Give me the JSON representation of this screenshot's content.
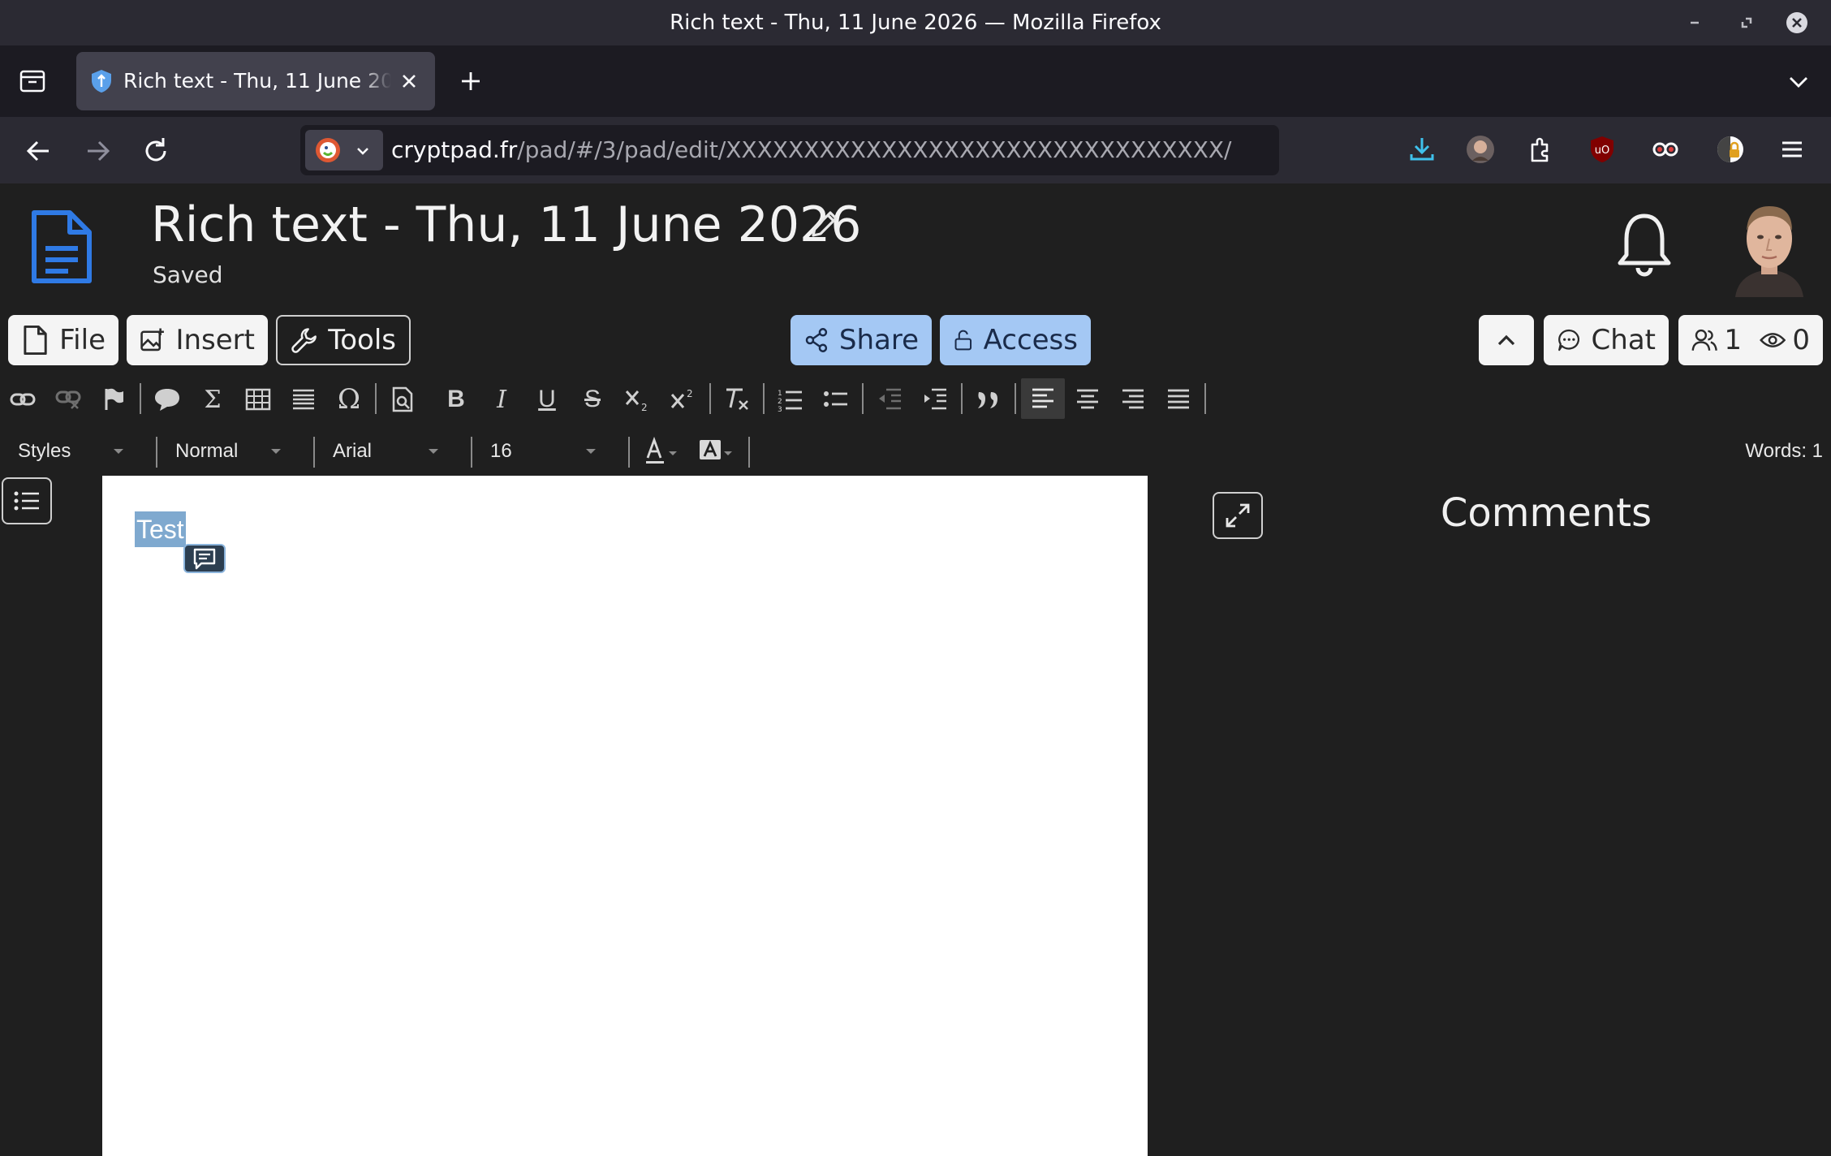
{
  "window": {
    "title": "Rich text - Thu, 11 June 2026 — Mozilla Firefox"
  },
  "browser": {
    "tab_title": "Rich text - Thu, 11 June 2026",
    "url_host": "cryptpad.fr",
    "url_path": "/pad/#/3/pad/edit/XXXXXXXXXXXXXXXXXXXXXXXXXXXXXXXX/"
  },
  "app": {
    "doc_title": "Rich text - Thu, 11 June 2026",
    "save_status": "Saved"
  },
  "toolbar": {
    "file_label": "File",
    "insert_label": "Insert",
    "tools_label": "Tools",
    "share_label": "Share",
    "access_label": "Access",
    "chat_label": "Chat",
    "users_count": "1",
    "viewers_count": "0"
  },
  "format_bar": {
    "omega_glyph": "Ω",
    "sigma_glyph": "Σ",
    "bold_glyph": "B",
    "italic_glyph": "I",
    "underline_glyph": "U",
    "strike_glyph": "S"
  },
  "style_bar": {
    "styles_label": "Styles",
    "format_value": "Normal",
    "font_value": "Arial",
    "size_value": "16",
    "word_count": "Words: 1"
  },
  "document": {
    "content_text": "Test"
  },
  "comments": {
    "title": "Comments"
  },
  "colors": {
    "accent_blue": "#a4c8f4",
    "selection": "#7fa9cf",
    "app_bg": "#1f1f1f"
  }
}
